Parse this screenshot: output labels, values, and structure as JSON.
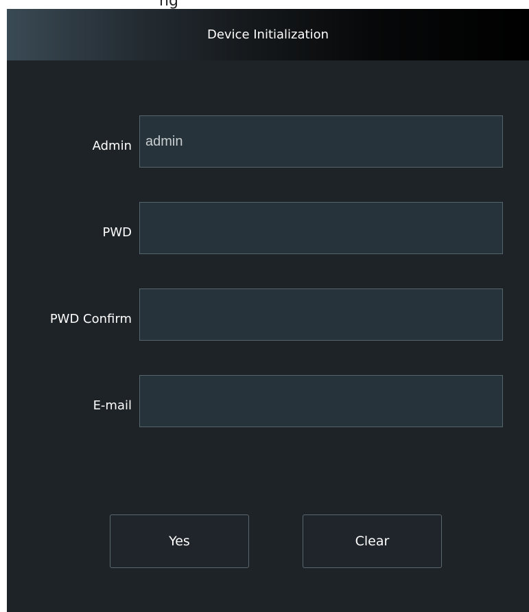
{
  "page_partial_text": "ng",
  "dialog": {
    "title": "Device Initialization"
  },
  "fields": {
    "admin": {
      "label": "Admin",
      "value": "admin"
    },
    "pwd": {
      "label": "PWD",
      "value": ""
    },
    "pwd_confirm": {
      "label": "PWD Confirm",
      "value": ""
    },
    "email": {
      "label": "E-mail",
      "value": ""
    }
  },
  "buttons": {
    "yes": "Yes",
    "clear": "Clear"
  },
  "colors": {
    "dialog_bg": "#1e2328",
    "field_bg": "#27333a",
    "field_border": "#56646c",
    "text": "#ffffff"
  }
}
